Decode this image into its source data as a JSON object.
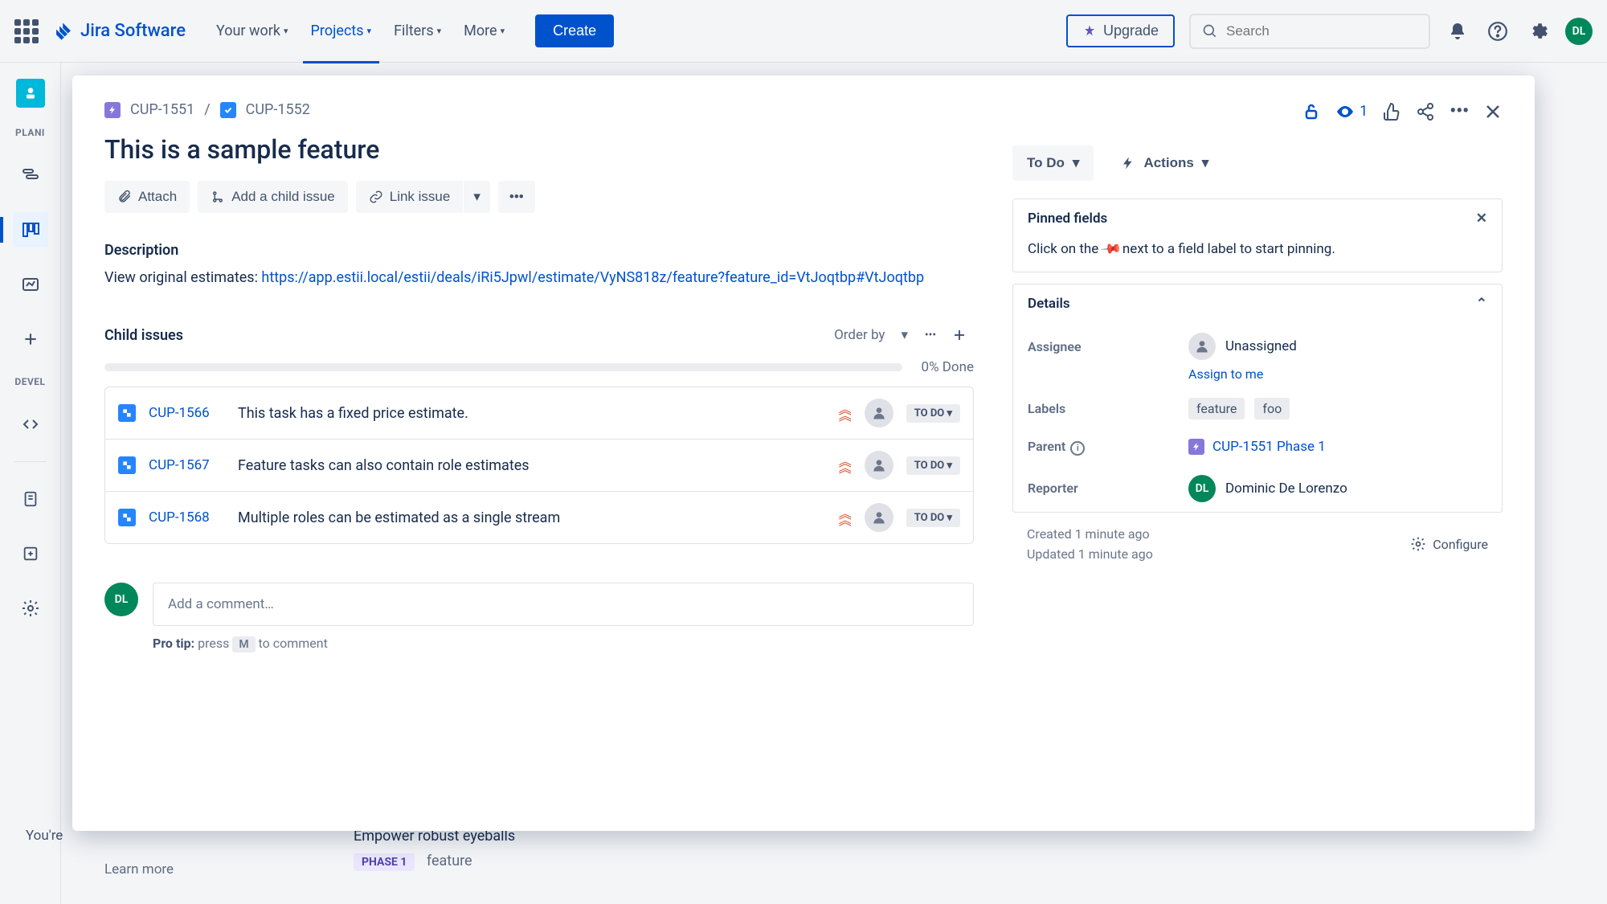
{
  "nav": {
    "logo": "Jira Software",
    "links": [
      "Your work",
      "Projects",
      "Filters",
      "More"
    ],
    "active_index": 1,
    "create": "Create",
    "upgrade": "Upgrade",
    "search_placeholder": "Search",
    "avatar_initials": "DL"
  },
  "rail": {
    "sections": [
      "PLANI",
      "DEVEL"
    ]
  },
  "breadcrumb": {
    "parent": "CUP-1551",
    "current": "CUP-1552"
  },
  "issue": {
    "title": "This is a sample feature",
    "attach": "Attach",
    "add_child": "Add a child issue",
    "link_issue": "Link issue",
    "description_label": "Description",
    "description_prefix": "View original estimates: ",
    "description_link": "https://app.estii.local/estii/deals/iRi5Jpwl/estimate/VyNS818z/feature?feature_id=VtJoqtbp#VtJoqtbp",
    "child_issues_label": "Child issues",
    "order_by": "Order by",
    "progress": "0% Done",
    "children": [
      {
        "key": "CUP-1566",
        "summary": "This task has a fixed price estimate.",
        "status": "TO DO"
      },
      {
        "key": "CUP-1567",
        "summary": "Feature tasks can also contain role estimates",
        "status": "TO DO"
      },
      {
        "key": "CUP-1568",
        "summary": "Multiple roles can be estimated as a single stream",
        "status": "TO DO"
      }
    ],
    "comment_placeholder": "Add a comment…",
    "protip_label": "Pro tip:",
    "protip_press": "press",
    "protip_key": "M",
    "protip_rest": "to comment"
  },
  "side": {
    "watch_count": "1",
    "status": "To Do",
    "actions": "Actions",
    "pinned_label": "Pinned fields",
    "pinned_hint_pre": "Click on the ",
    "pinned_hint_post": " next to a field label to start pinning.",
    "details_label": "Details",
    "assignee_label": "Assignee",
    "assignee_value": "Unassigned",
    "assign_to_me": "Assign to me",
    "labels_label": "Labels",
    "labels": [
      "feature",
      "foo"
    ],
    "parent_label": "Parent",
    "parent_value": "CUP-1551 Phase 1",
    "reporter_label": "Reporter",
    "reporter_value": "Dominic De Lorenzo",
    "reporter_initials": "DL",
    "created": "Created 1 minute ago",
    "updated": "Updated 1 minute ago",
    "configure": "Configure"
  },
  "bg": {
    "card_title": "Empower robust eyeballs",
    "phase": "PHASE 1",
    "feature": "feature",
    "youre": "You're",
    "learn": "Learn more"
  }
}
